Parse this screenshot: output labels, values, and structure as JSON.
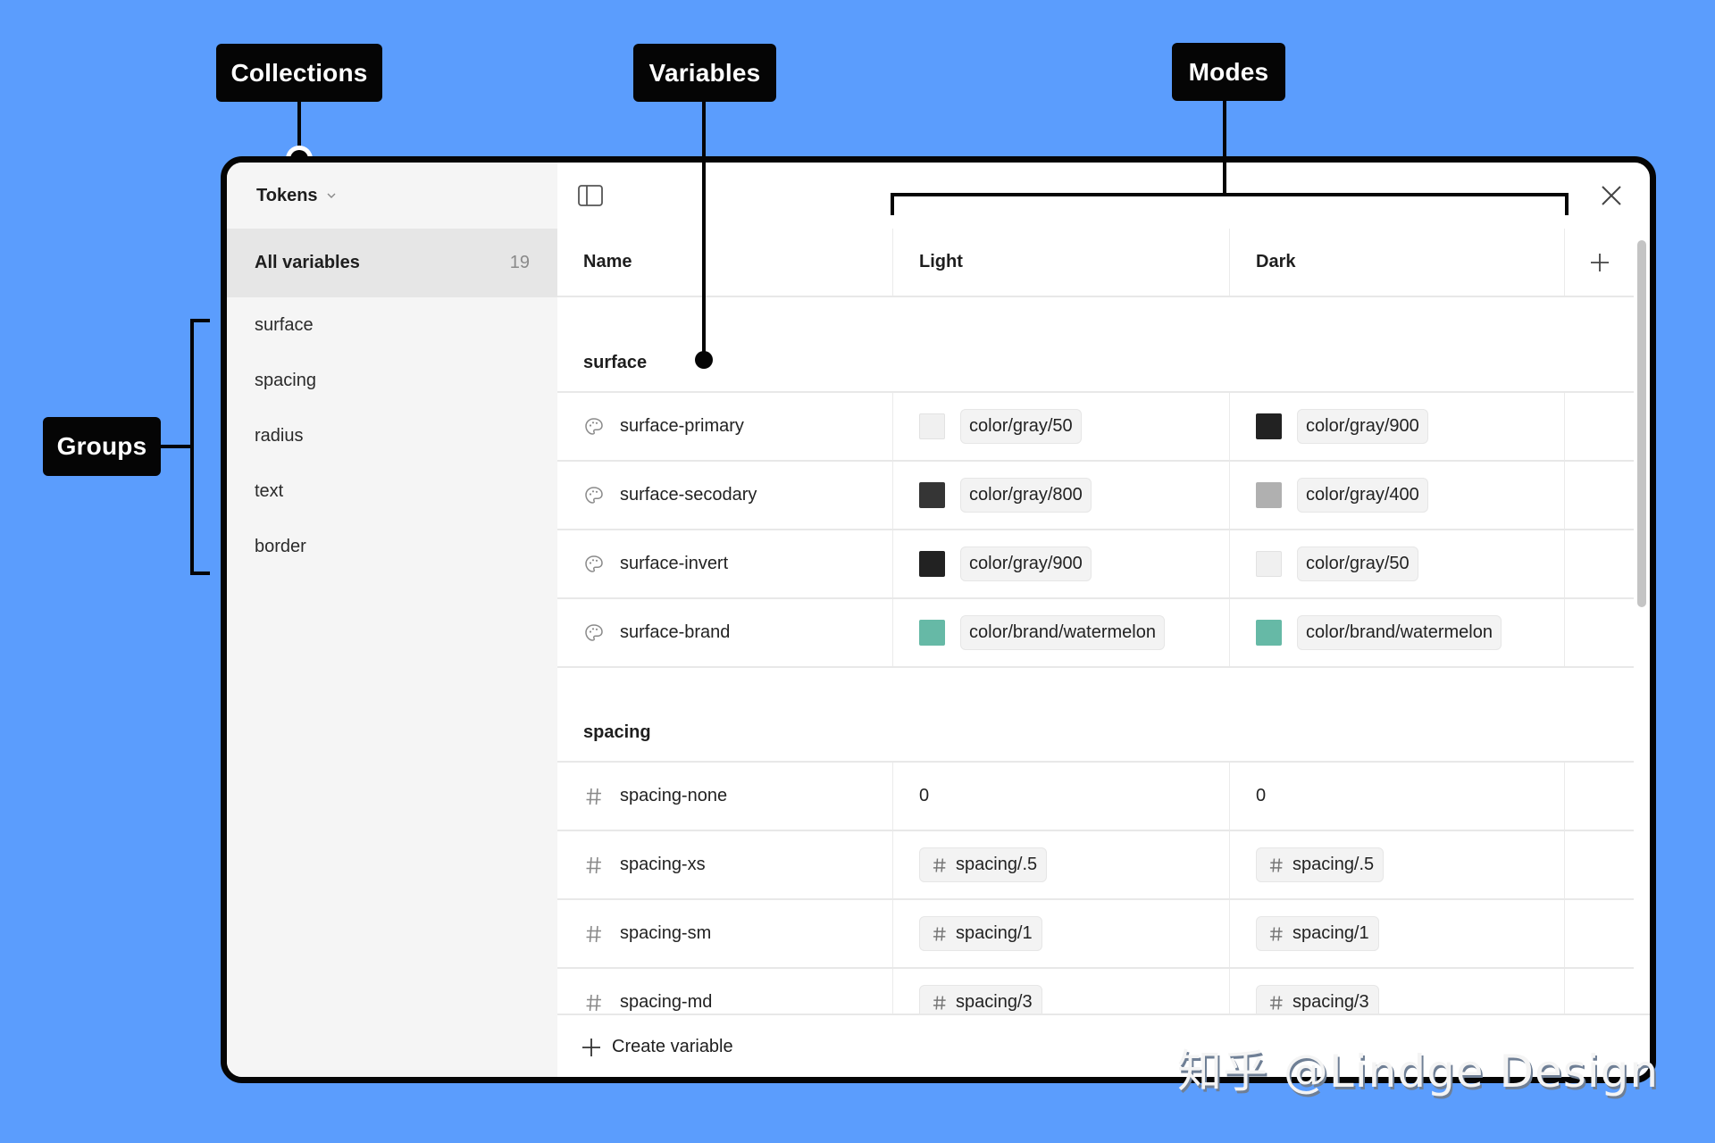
{
  "annotations": {
    "collections": "Collections",
    "variables": "Variables",
    "modes": "Modes",
    "groups": "Groups"
  },
  "sidebar": {
    "collection_name": "Tokens",
    "all_variables": {
      "label": "All variables",
      "count": "19"
    },
    "groups": [
      {
        "label": "surface"
      },
      {
        "label": "spacing"
      },
      {
        "label": "radius"
      },
      {
        "label": "text"
      },
      {
        "label": "border"
      }
    ]
  },
  "table": {
    "columns": {
      "name": "Name",
      "modes": [
        "Light",
        "Dark"
      ]
    },
    "groups": [
      {
        "title": "surface",
        "type": "color",
        "rows": [
          {
            "name": "surface-primary",
            "light": {
              "swatch": "#f0f0f0",
              "alias": "color/gray/50"
            },
            "dark": {
              "swatch": "#222222",
              "alias": "color/gray/900"
            }
          },
          {
            "name": "surface-secodary",
            "light": {
              "swatch": "#353535",
              "alias": "color/gray/800"
            },
            "dark": {
              "swatch": "#b0b0b0",
              "alias": "color/gray/400"
            }
          },
          {
            "name": "surface-invert",
            "light": {
              "swatch": "#222222",
              "alias": "color/gray/900"
            },
            "dark": {
              "swatch": "#f0f0f0",
              "alias": "color/gray/50"
            }
          },
          {
            "name": "surface-brand",
            "light": {
              "swatch": "#66b9a6",
              "alias": "color/brand/watermelon"
            },
            "dark": {
              "swatch": "#66b9a6",
              "alias": "color/brand/watermelon"
            }
          }
        ]
      },
      {
        "title": "spacing",
        "type": "number",
        "rows": [
          {
            "name": "spacing-none",
            "light": {
              "value": "0"
            },
            "dark": {
              "value": "0"
            }
          },
          {
            "name": "spacing-xs",
            "light": {
              "alias": "spacing/.5"
            },
            "dark": {
              "alias": "spacing/.5"
            }
          },
          {
            "name": "spacing-sm",
            "light": {
              "alias": "spacing/1"
            },
            "dark": {
              "alias": "spacing/1"
            }
          },
          {
            "name": "spacing-md",
            "light": {
              "alias": "spacing/3"
            },
            "dark": {
              "alias": "spacing/3"
            }
          }
        ]
      }
    ]
  },
  "footer": {
    "create_label": "Create variable"
  },
  "icons": {
    "collection_dropdown": "chevron-down-icon",
    "toggle_sidebar": "sidebar-panel-icon",
    "close": "close-icon",
    "add_mode": "plus-icon",
    "color_type": "palette-icon",
    "number_type": "hash-icon"
  },
  "watermark": "知乎 @Lindge Design",
  "colors": {
    "background": "#5b9dfd",
    "annotation": "#050505",
    "brand_watermelon": "#66b9a6"
  }
}
